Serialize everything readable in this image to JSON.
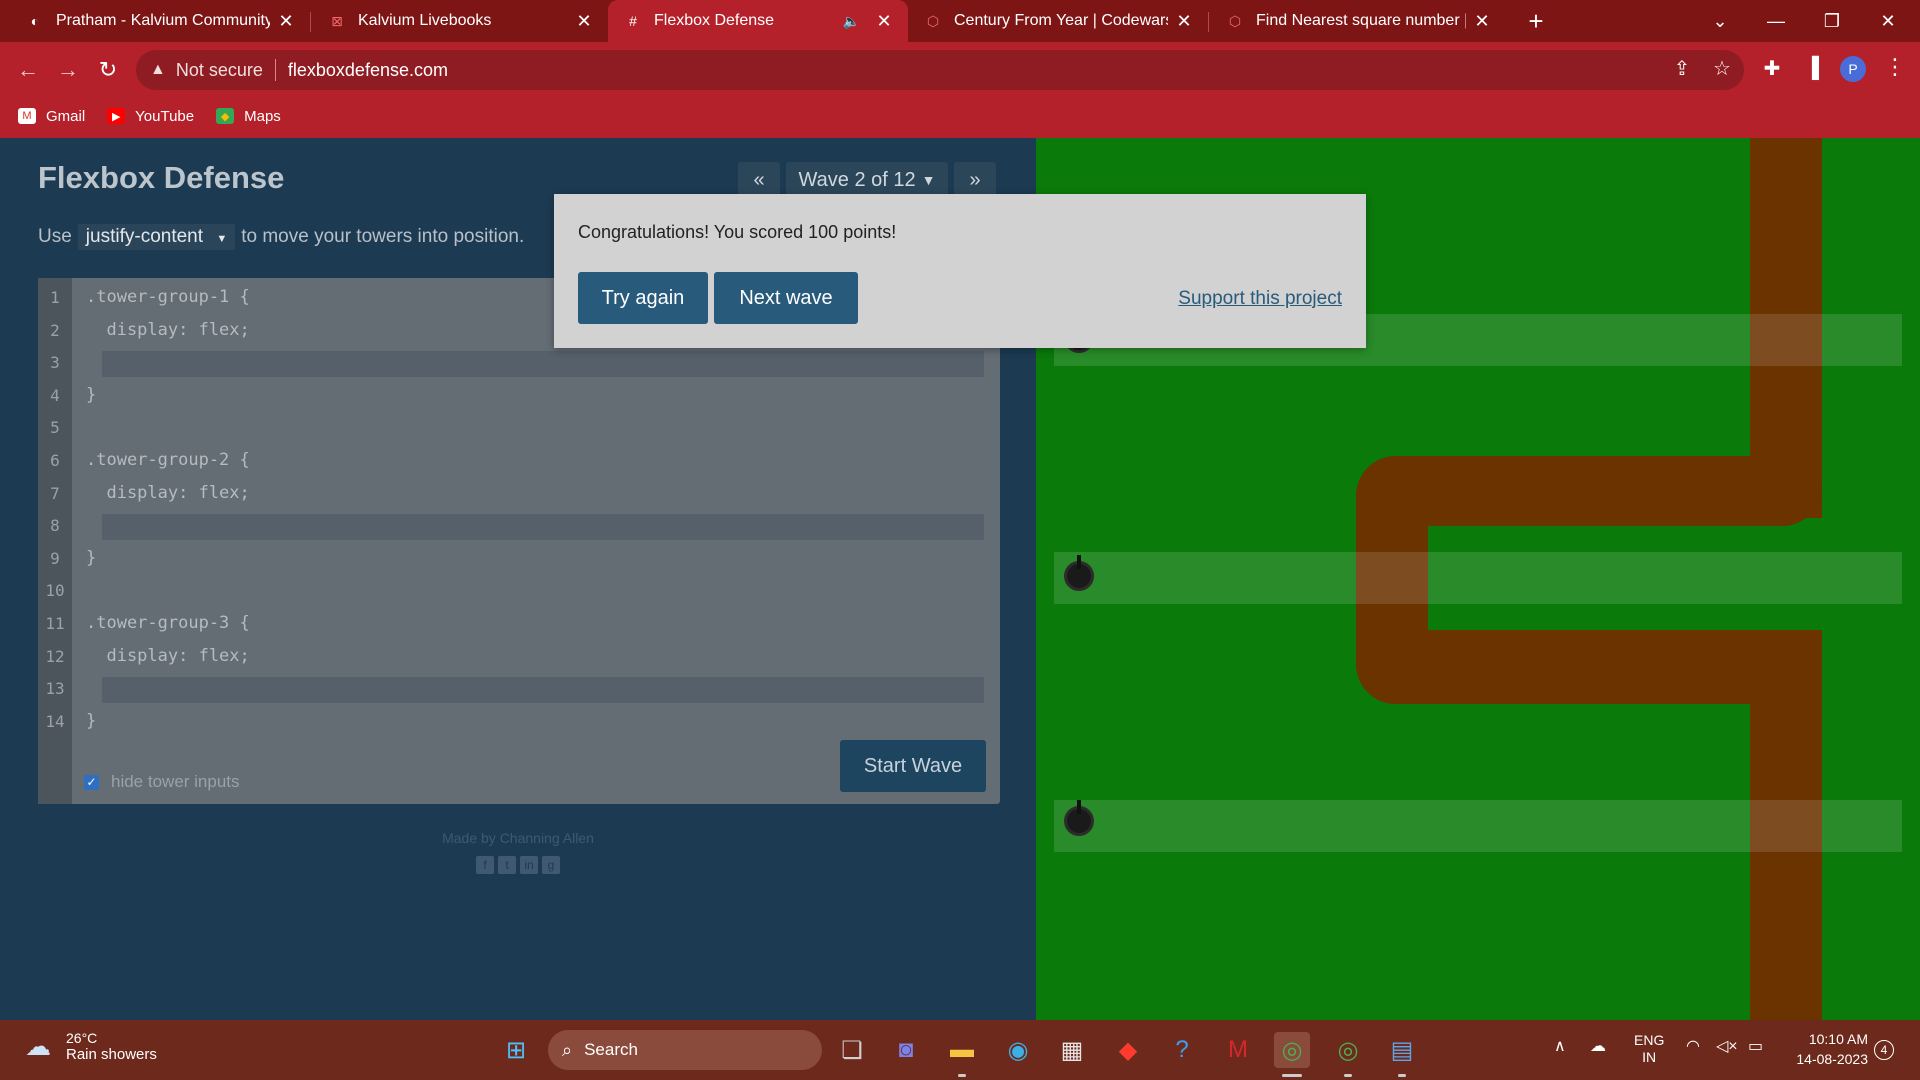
{
  "browser": {
    "tabs": [
      {
        "title": "Pratham - Kalvium Community W",
        "active": false
      },
      {
        "title": "Kalvium Livebooks",
        "active": false
      },
      {
        "title": "Flexbox Defense",
        "active": true
      },
      {
        "title": "Century From Year | Codewars",
        "active": false
      },
      {
        "title": "Find Nearest square number | Co",
        "active": false
      }
    ],
    "security_label": "Not secure",
    "url": "flexboxdefense.com",
    "profile_initial": "P",
    "bookmarks": [
      {
        "label": "Gmail"
      },
      {
        "label": "YouTube"
      },
      {
        "label": "Maps"
      }
    ]
  },
  "game": {
    "title": "Flexbox Defense",
    "wave_label": "Wave 2 of 12",
    "instruction_prefix": "Use",
    "instruction_property": "justify-content",
    "instruction_suffix": "to move your towers into position.",
    "code_lines": [
      ".tower-group-1 {",
      "  display: flex;",
      "",
      "}",
      "",
      ".tower-group-2 {",
      "  display: flex;",
      "",
      "}",
      "",
      ".tower-group-3 {",
      "  display: flex;",
      "",
      "}"
    ],
    "hide_inputs_label": "hide tower inputs",
    "hide_inputs_checked": true,
    "start_wave_label": "Start Wave",
    "made_by": "Made by Channing Allen"
  },
  "modal": {
    "message": "Congratulations! You scored 100 points!",
    "try_again_label": "Try again",
    "next_wave_label": "Next wave",
    "support_label": "Support this project"
  },
  "taskbar": {
    "temperature": "26°C",
    "weather": "Rain showers",
    "search_placeholder": "Search",
    "lang1": "ENG",
    "lang2": "IN",
    "time": "10:10 AM",
    "date": "14-08-2023",
    "notifications": "4"
  },
  "colors": {
    "tab_bar": "#7e1515",
    "toolbar": "#b5212a",
    "panel": "#1c3a52",
    "board_grass": "#0a7a0a",
    "board_path": "#6a3300",
    "modal_button": "#285a7c"
  }
}
